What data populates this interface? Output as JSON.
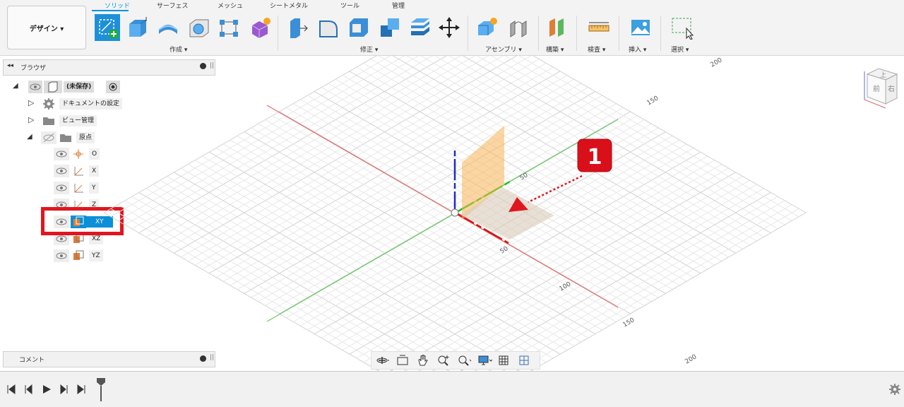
{
  "toolbar": {
    "workspace": "デザイン ▾",
    "tabs": [
      "ソリッド",
      "サーフェス",
      "メッシュ",
      "シートメタル",
      "ツール",
      "管理"
    ],
    "groups": {
      "create": "作成 ▾",
      "modify": "修正 ▾",
      "assemble": "アセンブリ ▾",
      "construct": "構築 ▾",
      "inspect": "検査 ▾",
      "insert": "挿入 ▾",
      "select": "選択 ▾"
    }
  },
  "browser": {
    "title": "ブラウザ",
    "root": "(未保存)",
    "doc_settings": "ドキュメントの設定",
    "named_views": "ビュー管理",
    "origin": "原点",
    "origin_items": [
      "O",
      "X",
      "Y",
      "Z",
      "XY",
      "XZ",
      "YZ"
    ]
  },
  "comments": {
    "title": "コメント"
  },
  "viewport": {
    "axis_ticks": [
      "200",
      "150",
      "50",
      "50",
      "100",
      "150",
      "200"
    ],
    "viewcube": {
      "top": "上",
      "front": "前",
      "right": "右"
    },
    "callout": "1"
  },
  "colors": {
    "accent": "#0696d7",
    "callout_red": "#d9101a",
    "highlight_red": "#e0161f"
  }
}
